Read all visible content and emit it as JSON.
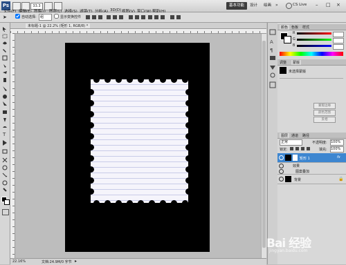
{
  "menubar": {
    "logo": "Ps",
    "zoom": "33.3",
    "items": [
      "文件(F)",
      "编辑(E)",
      "图像(I)",
      "图层(L)",
      "选择(S)",
      "滤镜(T)",
      "分析(A)",
      "3D(D)",
      "视图(V)",
      "窗口(W)",
      "帮助(H)"
    ],
    "workspaces": [
      "基本功能",
      "设计",
      "绘画"
    ],
    "live": "CS Live"
  },
  "options": {
    "auto_select_label": "自动选择:",
    "auto_select_value": "组",
    "show_transform": "显示变换控件"
  },
  "document": {
    "tab_title": "未标题-1 @ 22.2% (矩形 1, RGB/8) *",
    "zoom_status": "22.16%",
    "doc_status": "文档:24.9M/0 字节"
  },
  "panels": {
    "color_tabs": [
      "颜色",
      "色板",
      "样式"
    ],
    "color_labels": [
      "R",
      "G",
      "B"
    ],
    "adjust_tabs": [
      "调整",
      "蒙版"
    ],
    "mask_title": "未选择蒙版",
    "mask_buttons": [
      "像素蒙版",
      "矢量蒙版"
    ],
    "mask_btn_side": [
      "蒙版边缘",
      "颜色范围",
      "反相"
    ],
    "layers_tabs": [
      "图层",
      "通道",
      "路径"
    ],
    "blend_mode": "正常",
    "opacity_label": "不透明度:",
    "opacity_value": "100%",
    "lock_label": "锁定:",
    "fill_label": "填充:",
    "fill_value": "100%",
    "layers": [
      {
        "name": "矩形 1",
        "fx": "fx"
      },
      {
        "name": "效果"
      },
      {
        "name": "图案叠加"
      },
      {
        "name": "背景"
      }
    ]
  },
  "watermark": {
    "text": "Bai 经验",
    "sub": "jingyan.baidu.com"
  },
  "colors": {
    "accent": "#3d86d0",
    "black": "#000000"
  }
}
